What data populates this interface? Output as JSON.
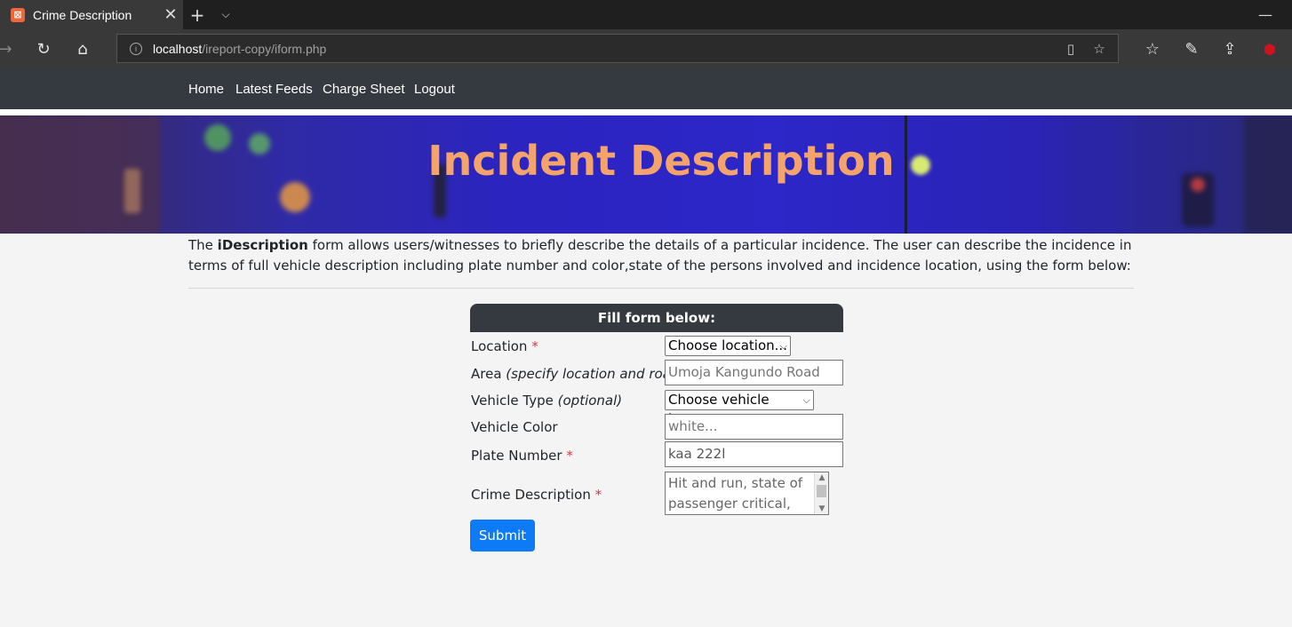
{
  "browser": {
    "tab_title": "Crime Description",
    "tab_favicon": "xampp-icon",
    "address_host": "localhost",
    "address_path": "/ireport-copy/iform.php"
  },
  "sitenav": {
    "items": [
      "Home",
      "Latest Feeds",
      "Charge Sheet",
      "Logout"
    ]
  },
  "banner": {
    "title": "Incident Description"
  },
  "intro": {
    "lead": "The ",
    "brand": "iDescription",
    "text": " form allows users/witnesses to briefly describe the details of a particular incidence. The user can describe the incidence in terms of full vehicle description including plate number and color,state of the persons involved and incidence location, using the form below:"
  },
  "form": {
    "header": "Fill form below:",
    "location_label": "Location",
    "location_value": "Choose location...",
    "area_label": "Area ",
    "area_hint": "(specify location and road)",
    "area_placeholder": "Umoja Kangundo Road",
    "vehicle_type_label": "Vehicle Type ",
    "vehicle_type_hint": "(optional)",
    "vehicle_type_value": "Choose vehicle type...",
    "vehicle_color_label": "Vehicle Color",
    "vehicle_color_placeholder": "white...",
    "plate_label": "Plate Number",
    "plate_value": "kaa 222l",
    "crime_label": "Crime Description",
    "crime_value": "Hit and run, state of passenger critical, need",
    "required_mark": "*",
    "submit_label": "Submit"
  },
  "colors": {
    "navbar": "#343a40",
    "banner_title": "#f4a36a",
    "primary_button": "#0d7bf5",
    "required": "#dc3545"
  }
}
